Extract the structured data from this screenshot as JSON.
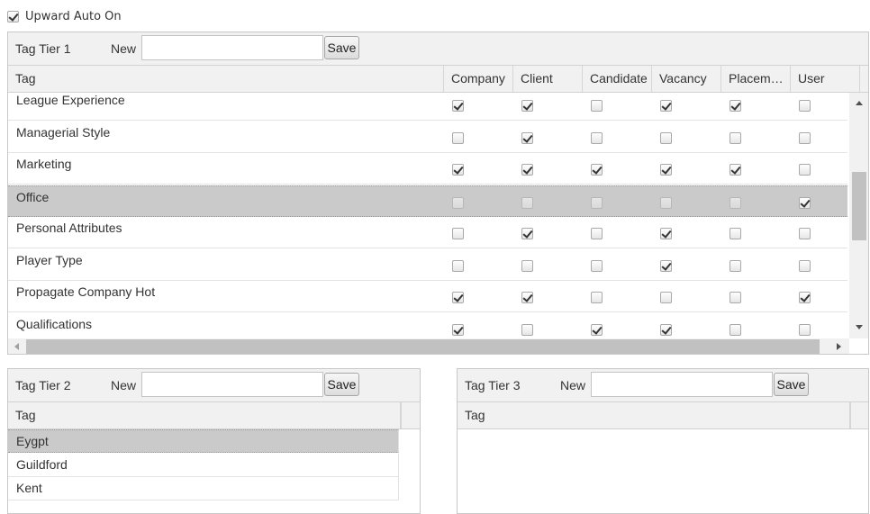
{
  "upward_auto": {
    "label": "Upward Auto On",
    "checked": true
  },
  "tier1": {
    "title": "Tag Tier 1",
    "new_label": "New",
    "new_value": "",
    "save_label": "Save",
    "columns": [
      "Tag",
      "Company",
      "Client",
      "Candidate",
      "Vacancy",
      "Placem…",
      "User"
    ],
    "rows": [
      {
        "tag": "League Experience",
        "checks": [
          true,
          true,
          false,
          true,
          true,
          false
        ],
        "selected": false
      },
      {
        "tag": "Managerial Style",
        "checks": [
          false,
          true,
          false,
          false,
          false,
          false
        ],
        "selected": false
      },
      {
        "tag": "Marketing",
        "checks": [
          true,
          true,
          true,
          true,
          true,
          false
        ],
        "selected": false
      },
      {
        "tag": "Office",
        "checks": [
          false,
          false,
          false,
          false,
          false,
          true
        ],
        "selected": true
      },
      {
        "tag": "Personal Attributes",
        "checks": [
          false,
          true,
          false,
          true,
          false,
          false
        ],
        "selected": false
      },
      {
        "tag": "Player Type",
        "checks": [
          false,
          false,
          false,
          true,
          false,
          false
        ],
        "selected": false
      },
      {
        "tag": "Propagate Company Hot",
        "checks": [
          true,
          true,
          false,
          false,
          false,
          true
        ],
        "selected": false
      },
      {
        "tag": "Qualifications",
        "checks": [
          true,
          false,
          true,
          true,
          false,
          false
        ],
        "selected": false
      }
    ]
  },
  "tier2": {
    "title": "Tag Tier 2",
    "new_label": "New",
    "new_value": "",
    "save_label": "Save",
    "column": "Tag",
    "rows": [
      {
        "tag": "Eygpt",
        "selected": true
      },
      {
        "tag": "Guildford",
        "selected": false
      },
      {
        "tag": "Kent",
        "selected": false
      }
    ]
  },
  "tier3": {
    "title": "Tag Tier 3",
    "new_label": "New",
    "new_value": "",
    "save_label": "Save",
    "column": "Tag",
    "rows": []
  }
}
